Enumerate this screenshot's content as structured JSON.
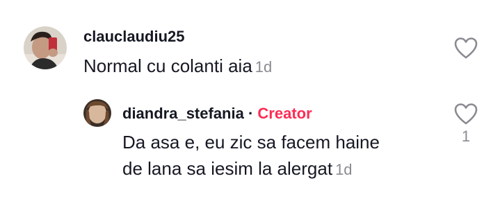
{
  "comments": [
    {
      "username": "clauclaudiu25",
      "text": "Normal cu colanti aia",
      "timestamp": "1d",
      "like_icon": "heart-outline-icon"
    }
  ],
  "reply": {
    "username": "diandra_stefania",
    "separator": "·",
    "badge": "Creator",
    "text_line1": "Da asa e, eu zic sa facem haine",
    "text_line2": "de lana sa iesim la alergat",
    "timestamp": "1d",
    "like_icon": "heart-outline-icon",
    "like_count": "1"
  },
  "colors": {
    "text": "#161823",
    "muted": "#8a8b91",
    "creator_badge": "#fe2c55",
    "heart_stroke": "#8a8b91"
  }
}
